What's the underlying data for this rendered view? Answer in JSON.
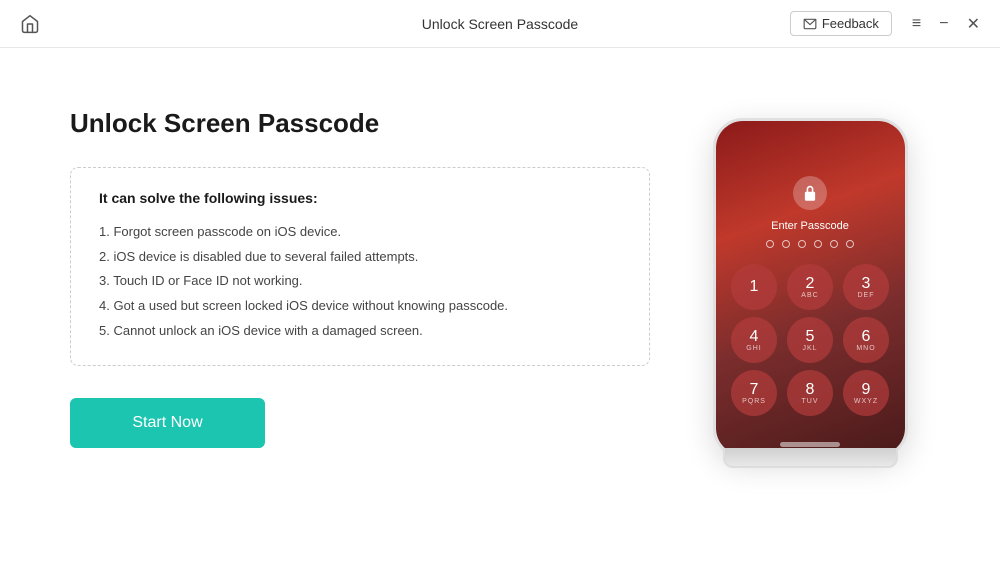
{
  "titlebar": {
    "title": "Unlock Screen Passcode",
    "feedback_label": "Feedback",
    "home_icon": "⌂"
  },
  "main": {
    "page_title": "Unlock Screen Passcode",
    "issues_box": {
      "title": "It can solve the following issues:",
      "items": [
        "1. Forgot screen passcode on iOS device.",
        "2. iOS device is disabled due to several failed attempts.",
        "3. Touch ID or Face ID not working.",
        "4. Got a used but screen locked iOS device without knowing passcode.",
        "5. Cannot unlock an iOS device with a damaged screen."
      ]
    },
    "start_button_label": "Start Now"
  },
  "phone": {
    "enter_passcode": "Enter Passcode",
    "numpad": [
      {
        "main": "1",
        "sub": ""
      },
      {
        "main": "2",
        "sub": "ABC"
      },
      {
        "main": "3",
        "sub": "DEF"
      },
      {
        "main": "4",
        "sub": "GHI"
      },
      {
        "main": "5",
        "sub": "JKL"
      },
      {
        "main": "6",
        "sub": "MNO"
      },
      {
        "main": "7",
        "sub": "PQRS"
      },
      {
        "main": "8",
        "sub": "TUV"
      },
      {
        "main": "9",
        "sub": "WXYZ"
      }
    ]
  },
  "window_controls": {
    "menu_label": "≡",
    "minimize_label": "−",
    "close_label": "✕"
  }
}
